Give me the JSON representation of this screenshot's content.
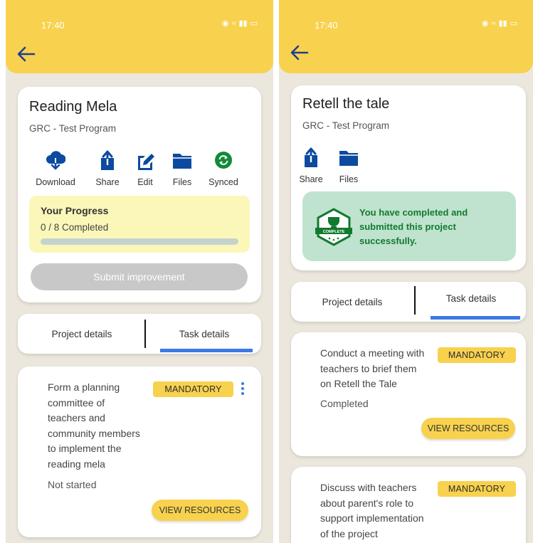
{
  "colors": {
    "accent_yellow": "#f8d24e",
    "brand_blue": "#0b4a9e",
    "synced_green": "#138a36",
    "success_bg": "#bfe3cf",
    "success_text": "#127a2e",
    "progress_bg": "#fbf7b9",
    "tab_underline": "#3b79e6",
    "background": "#ece7dd"
  },
  "left": {
    "status_time": "17:40",
    "project": {
      "title": "Reading Mela",
      "program": "GRC - Test Program"
    },
    "actions": [
      {
        "label": "Download",
        "icon": "cloud-download-icon"
      },
      {
        "label": "Share",
        "icon": "share-icon"
      },
      {
        "label": "Edit",
        "icon": "edit-icon"
      },
      {
        "label": "Files",
        "icon": "folder-icon"
      },
      {
        "label": "Synced",
        "icon": "sync-icon"
      }
    ],
    "progress": {
      "title": "Your Progress",
      "count_text": "0 / 8 Completed",
      "fraction": 0
    },
    "submit_label": "Submit improvement",
    "tabs": [
      {
        "label": "Project details",
        "active": false
      },
      {
        "label": "Task details",
        "active": true
      }
    ],
    "tasks": [
      {
        "lines": [
          "Form a planning",
          "committee of",
          "teachers and",
          "community members",
          "to implement the",
          "reading mela"
        ],
        "status": "Not started",
        "badge": "MANDATORY",
        "resources_label": "VIEW RESOURCES"
      }
    ]
  },
  "right": {
    "status_time": "17:40",
    "project": {
      "title": "Retell the tale",
      "program": "GRC - Test Program"
    },
    "actions": [
      {
        "label": "Share",
        "icon": "share-icon"
      },
      {
        "label": "Files",
        "icon": "folder-icon"
      }
    ],
    "success": {
      "badge_text": "COMPLETE",
      "lines": [
        "You have completed and",
        "submitted this project",
        "successfully."
      ]
    },
    "tabs": [
      {
        "label": "Project details",
        "active": false
      },
      {
        "label": "Task details",
        "active": true
      }
    ],
    "tasks": [
      {
        "lines": [
          "Conduct a meeting with",
          "teachers to brief them",
          "on Retell the Tale"
        ],
        "status": "Completed",
        "badge": "MANDATORY",
        "resources_label": "VIEW RESOURCES"
      },
      {
        "lines": [
          "Discuss with teachers",
          "about parent's role to",
          "support implementation",
          "of the project"
        ],
        "badge": "MANDATORY"
      }
    ]
  }
}
